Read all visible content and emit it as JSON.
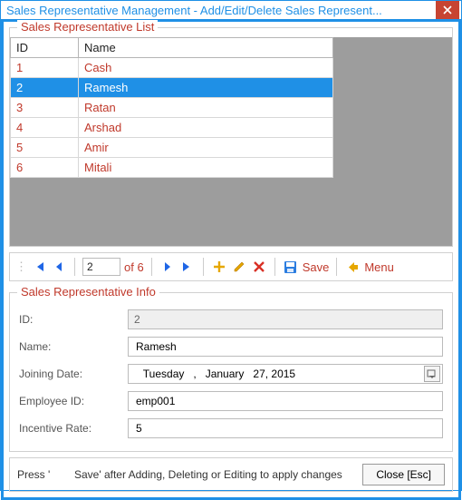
{
  "window": {
    "title": "Sales Representative Management - Add/Edit/Delete Sales Represent..."
  },
  "list": {
    "caption": "Sales Representative List",
    "columns": {
      "id": "ID",
      "name": "Name"
    },
    "rows": [
      {
        "id": "1",
        "name": "Cash"
      },
      {
        "id": "2",
        "name": "Ramesh"
      },
      {
        "id": "3",
        "name": "Ratan"
      },
      {
        "id": "4",
        "name": "Arshad"
      },
      {
        "id": "5",
        "name": "Amir"
      },
      {
        "id": "6",
        "name": "Mitali"
      }
    ],
    "selected_index": 1
  },
  "toolbar": {
    "page_value": "2",
    "of_label": "of 6",
    "save_label": "Save",
    "menu_label": "Menu"
  },
  "info": {
    "caption": "Sales Representative Info",
    "labels": {
      "id": "ID:",
      "name": "Name:",
      "joining": "Joining Date:",
      "empid": "Employee ID:",
      "incentive": "Incentive Rate:"
    },
    "values": {
      "id": "2",
      "name": "Ramesh",
      "joining": "   Tuesday   ,   January   27, 2015",
      "empid": "emp001",
      "incentive": "5"
    }
  },
  "bottom": {
    "hint": "Press '        Save' after Adding, Deleting or Editing to apply changes",
    "close": "Close [Esc]"
  }
}
